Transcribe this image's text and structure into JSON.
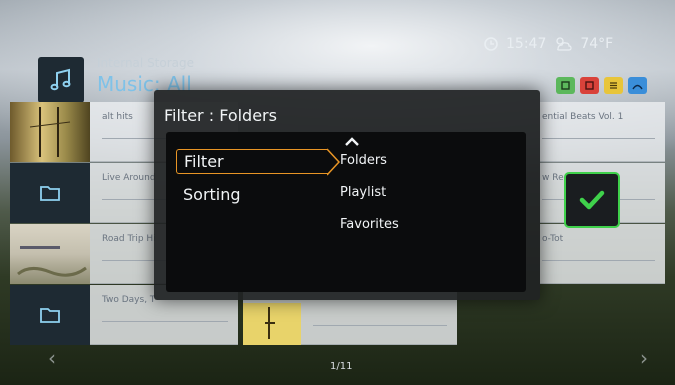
{
  "header": {
    "storage": "Internal Storage",
    "breadcrumb": "Music: All",
    "time": "15:47",
    "weather": "74°F"
  },
  "tiles_left": [
    {
      "title": "alt hits",
      "kind": "cover"
    },
    {
      "title": "Live Around",
      "kind": "folder"
    },
    {
      "title": "Road Trip Hi",
      "kind": "cover"
    },
    {
      "title": "Two Days, T",
      "kind": "folder"
    }
  ],
  "tiles_right": [
    {
      "title": "ential Beats Vol. 1"
    },
    {
      "title": "w Re"
    },
    {
      "title": "o-Tot"
    }
  ],
  "dialog": {
    "title": "Filter : Folders",
    "menu": [
      "Filter",
      "Sorting"
    ],
    "options": [
      "Folders",
      "Playlist",
      "Favorites"
    ]
  },
  "footer": {
    "page": "1/11"
  },
  "colors": {
    "accent_orange": "#e89525",
    "check_green": "#3fd14b",
    "breadcrumb_blue": "#7fc2e8",
    "btn_green": "#5cb85c",
    "btn_red": "#d9423a",
    "btn_yellow": "#e8c53a",
    "btn_blue": "#3a8ed9"
  }
}
